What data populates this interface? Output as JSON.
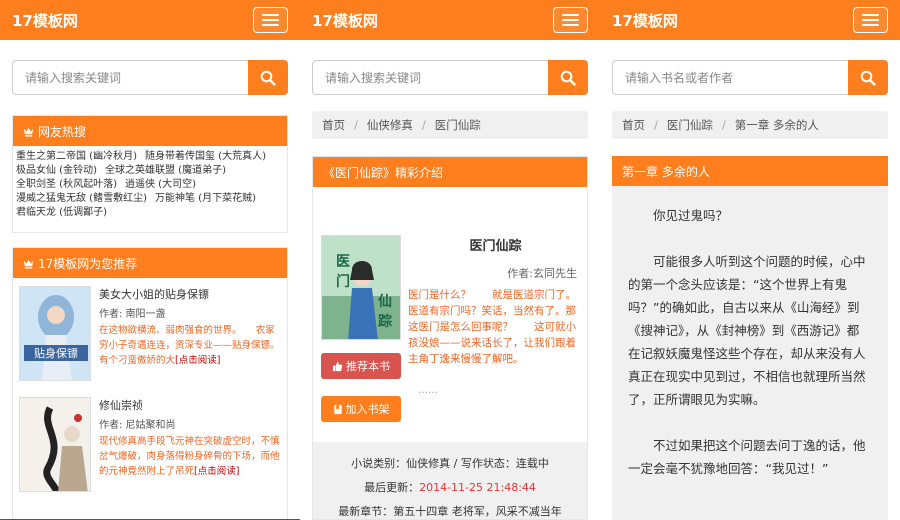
{
  "colors": {
    "accent": "#ff7f1e",
    "recommend": "#d9534f",
    "desc_text": "#f26522"
  },
  "icons": {
    "search": "magnifier-icon",
    "menu": "hamburger-icon",
    "crown": "crown-icon",
    "thumb": "thumbs-up-icon",
    "bookmark": "bookmark-icon"
  },
  "panel1": {
    "logo": "17模板网",
    "search_placeholder": "请输入搜索关键词",
    "hot_title": "网友热搜",
    "hot_rows": [
      [
        "重生之第二帝国 (幽冷秋月)",
        "随身带着传国玺 (大荒真人)"
      ],
      [
        "极品女仙 (金铃动)",
        "全球之英雄联盟 (魔道弟子)"
      ],
      [
        "全职剑圣 (秋风起叶落)",
        "逍遥侠 (大司空)"
      ],
      [
        "漫威之猛鬼无敌 (鳍雪敷红尘)",
        "万能神笔 (月下菜花贼)"
      ],
      [
        "君临天龙 (低调鄙子)"
      ]
    ],
    "rec_title": "17模板网为您推荐",
    "rec_items": [
      {
        "title": "美女大小姐的贴身保镖",
        "author": "作者: 南阳一盏",
        "desc": "在这物欲横流、弱肉强食的世界。　　农家穷小子奇遇连连，资深专业——贴身保镖。　　有个刁蛮傲娇的大",
        "more": "[点击阅读]"
      },
      {
        "title": "修仙崇祯",
        "author": "作者: 尼姑聚和尚",
        "desc": "现代修真高手段飞元神在突破虚空时，不慎岔气爆破，肉身落得粉身碎骨的下场，而他的元神竟然附上了吊死",
        "more": "[点击阅读]"
      }
    ]
  },
  "panel2": {
    "logo": "17模板网",
    "search_placeholder": "请输入搜索关键词",
    "breadcrumb": [
      "首页",
      "仙侠修真",
      "医门仙踪"
    ],
    "intro_title": "《医门仙踪》精彩介绍",
    "book_title": "医门仙踪",
    "book_author": "作者:玄同先生",
    "book_desc": "医门是什么？　　就是医道宗门了。　　医道有宗门吗？笑话，当然有了。那这医门是怎么回事呢？　　这可就小孩没娘——说来话长了，让我们跟着主角丁逸来慢慢了解吧。",
    "ellipsis": "……",
    "btn_recommend": "推荐本书",
    "btn_shelf": "加入书架",
    "meta_category": "小说类别：仙侠修真 / 写作状态：连载中",
    "meta_updated_label": "最后更新：",
    "meta_updated_value": "2014-11-25 21:48:44",
    "meta_latest": "最新章节：第五十四章 老将军，风采不减当年"
  },
  "panel3": {
    "logo": "17模板网",
    "search_placeholder": "请输入书名或者作者",
    "breadcrumb": [
      "首页",
      "医门仙踪",
      "第一章 多余的人"
    ],
    "chapter_title": "第一章 多余的人",
    "paragraphs": [
      "你见过鬼吗？",
      "可能很多人听到这个问题的时候，心中的第一个念头应该是：“这个世界上有鬼吗？”的确如此，自古以来从《山海经》到《搜神记》，从《封神榜》到《西游记》都在记叙妖魔鬼怪这些个存在，却从来没有人真正在现实中见到过，不相信也就理所当然了，正所谓眼见为实嘛。",
      "不过如果把这个问题去问丁逸的话，他一定会毫不犹豫地回答：“我见过！”"
    ]
  }
}
